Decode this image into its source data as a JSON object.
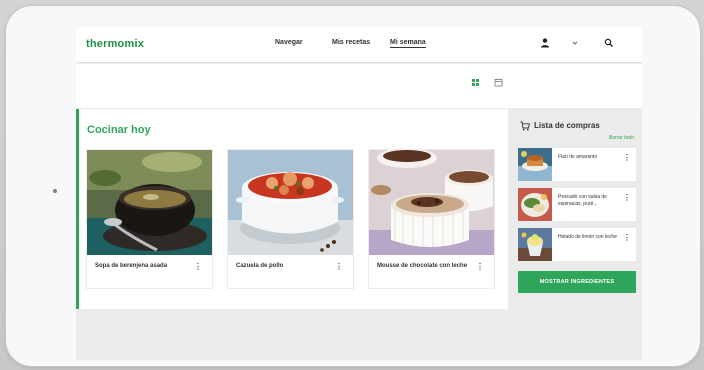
{
  "header": {
    "logo": "thermomix",
    "nav": [
      "Navegar",
      "Mis recetas",
      "Mi semana"
    ],
    "active_nav": "Mi semana",
    "icons": [
      "user-icon",
      "chevron-down-icon",
      "search-icon"
    ]
  },
  "view_toggle": {
    "icons": [
      "grid-view-icon",
      "calendar-icon"
    ],
    "active": "grid-view-icon"
  },
  "main": {
    "section_title": "Cocinar hoy",
    "recipes": [
      {
        "name": "Sopa de berenjena asada",
        "image": "eggplant-soup-bowl"
      },
      {
        "name": "Cazuela de pollo",
        "image": "chicken-casserole"
      },
      {
        "name": "Mousse de chocolate con leche",
        "image": "chocolate-mousse-cups"
      }
    ],
    "more_icon": "⋮"
  },
  "shopping_list": {
    "title": "Lista de compras",
    "edit_label": "Borrar todo",
    "items": [
      {
        "name": "Flan de amaranto"
      },
      {
        "name": "Pescado con salsa de espinacas, puré..."
      },
      {
        "name": "Helado de limón con leche"
      }
    ],
    "button_label": "MOSTRAR INGREDIENTES"
  },
  "colors": {
    "brand_green": "#2ea55a",
    "logo_green": "#1e8f43",
    "text": "#333333",
    "panel_gray": "#ebebeb"
  }
}
